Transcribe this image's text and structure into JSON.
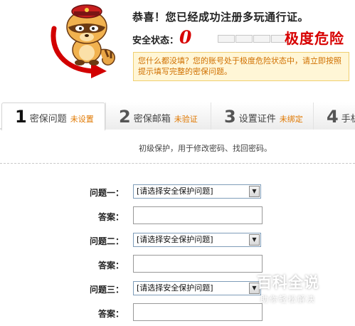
{
  "header": {
    "congrats": "恭喜！您已经成功注册多玩通行证。",
    "security_label": "安全状态：",
    "security_score": "0",
    "security_level": "极度危险",
    "warning": "您什么都没填？您的账号处于极度危险状态中，请立即按照提示填写完整的密保问题。"
  },
  "tabs": [
    {
      "num": "1",
      "label": "密保问题",
      "status": "未设置"
    },
    {
      "num": "2",
      "label": "密保邮箱",
      "status": "未验证"
    },
    {
      "num": "3",
      "label": "设置证件",
      "status": "未绑定"
    },
    {
      "num": "4",
      "label": "手机",
      "status": ""
    }
  ],
  "intro": "初级保护，用于修改密码、找回密码。",
  "form": {
    "question1_label": "问题一：",
    "question2_label": "问题二：",
    "question3_label": "问题三：",
    "answer_label": "答案：",
    "select_value": "[请选择安全保护问题]"
  },
  "watermark": {
    "title": "百科全说",
    "subtitle": "助你轻松解决"
  },
  "colors": {
    "danger": "#d70000",
    "warning_text": "#d07000",
    "warning_bg": "#fff6d6",
    "tab_status": "#e07800"
  }
}
